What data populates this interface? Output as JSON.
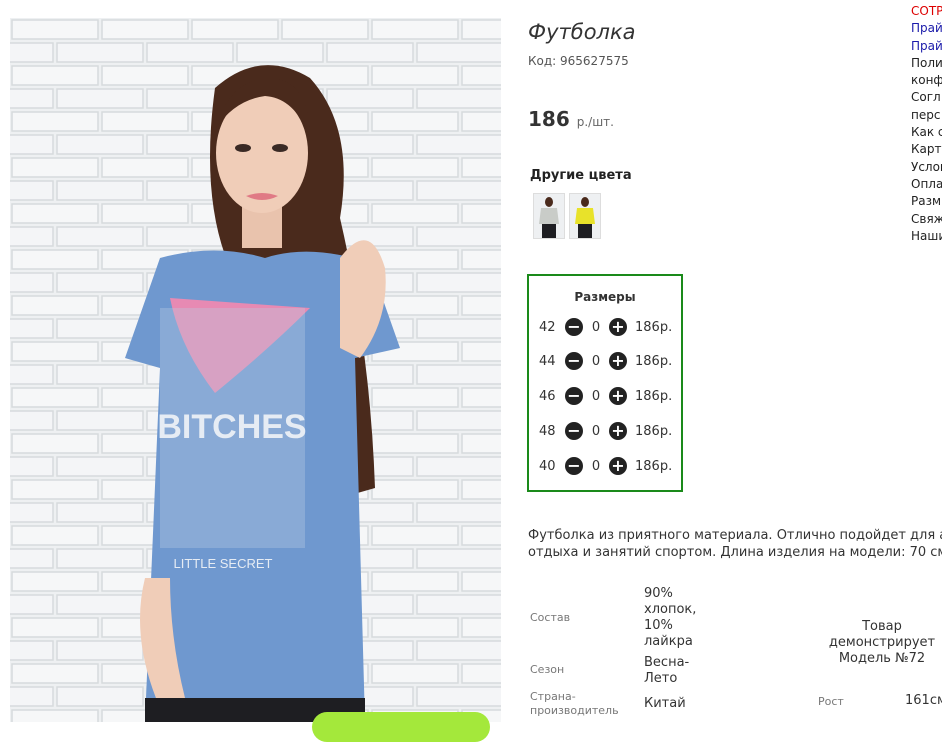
{
  "product": {
    "title": "Футболка",
    "code": "Код: 965627575",
    "price": "186",
    "price_unit": "р./шт."
  },
  "photo": {
    "print_text": "BITCHES",
    "print_subtext": "LITTLE SECRET"
  },
  "other_colors": {
    "title": "Другие цвета",
    "swatches": [
      {
        "name": "grey",
        "color": "#c9ccc8"
      },
      {
        "name": "yellow",
        "color": "#e8e22a"
      }
    ]
  },
  "sizes": {
    "title": "Размеры",
    "rows": [
      {
        "size": "42",
        "qty": "0",
        "price": "186р."
      },
      {
        "size": "44",
        "qty": "0",
        "price": "186р."
      },
      {
        "size": "46",
        "qty": "0",
        "price": "186р."
      },
      {
        "size": "48",
        "qty": "0",
        "price": "186р."
      },
      {
        "size": "40",
        "qty": "0",
        "price": "186р."
      }
    ],
    "minus_icon": "−",
    "plus_icon": "+"
  },
  "description": {
    "line1": "Футболка из приятного материала. Отлично подойдет для акти",
    "line2": "отдыха и занятий спортом. Длина изделия на модели: 70 см."
  },
  "specs": {
    "composition_label": "Состав",
    "composition_value": [
      "90%",
      "хлопок,",
      "10%",
      "лайкра"
    ],
    "season_label": "Сезон",
    "season_value": [
      "Весна-",
      "Лето"
    ],
    "country_label": [
      "Страна-",
      "производитель"
    ],
    "country_value": "Китай",
    "model_note": [
      "Товар",
      "демонстрирует",
      "Модель №72"
    ],
    "height_label": "Рост",
    "height_value": "161см"
  },
  "side_links": [
    {
      "text": "СОТР",
      "style": "red"
    },
    {
      "text": "Прай",
      "style": "blue"
    },
    {
      "text": "Прай",
      "style": "blue"
    },
    {
      "text": "Поли",
      "style": "plain"
    },
    {
      "text": "конф",
      "style": "plain"
    },
    {
      "text": "Согл",
      "style": "plain"
    },
    {
      "text": "перс",
      "style": "plain"
    },
    {
      "text": "Как с",
      "style": "plain"
    },
    {
      "text": "Карт",
      "style": "plain"
    },
    {
      "text": "Услов",
      "style": "plain"
    },
    {
      "text": "Опла",
      "style": "plain"
    },
    {
      "text": "Разм",
      "style": "plain"
    },
    {
      "text": "Свяж",
      "style": "plain"
    },
    {
      "text": "Наши",
      "style": "plain"
    }
  ],
  "colors": {
    "sizes_border": "#1a8a1a",
    "cta_green": "#a4e83b",
    "shirt_blue": "#6f98cf"
  }
}
